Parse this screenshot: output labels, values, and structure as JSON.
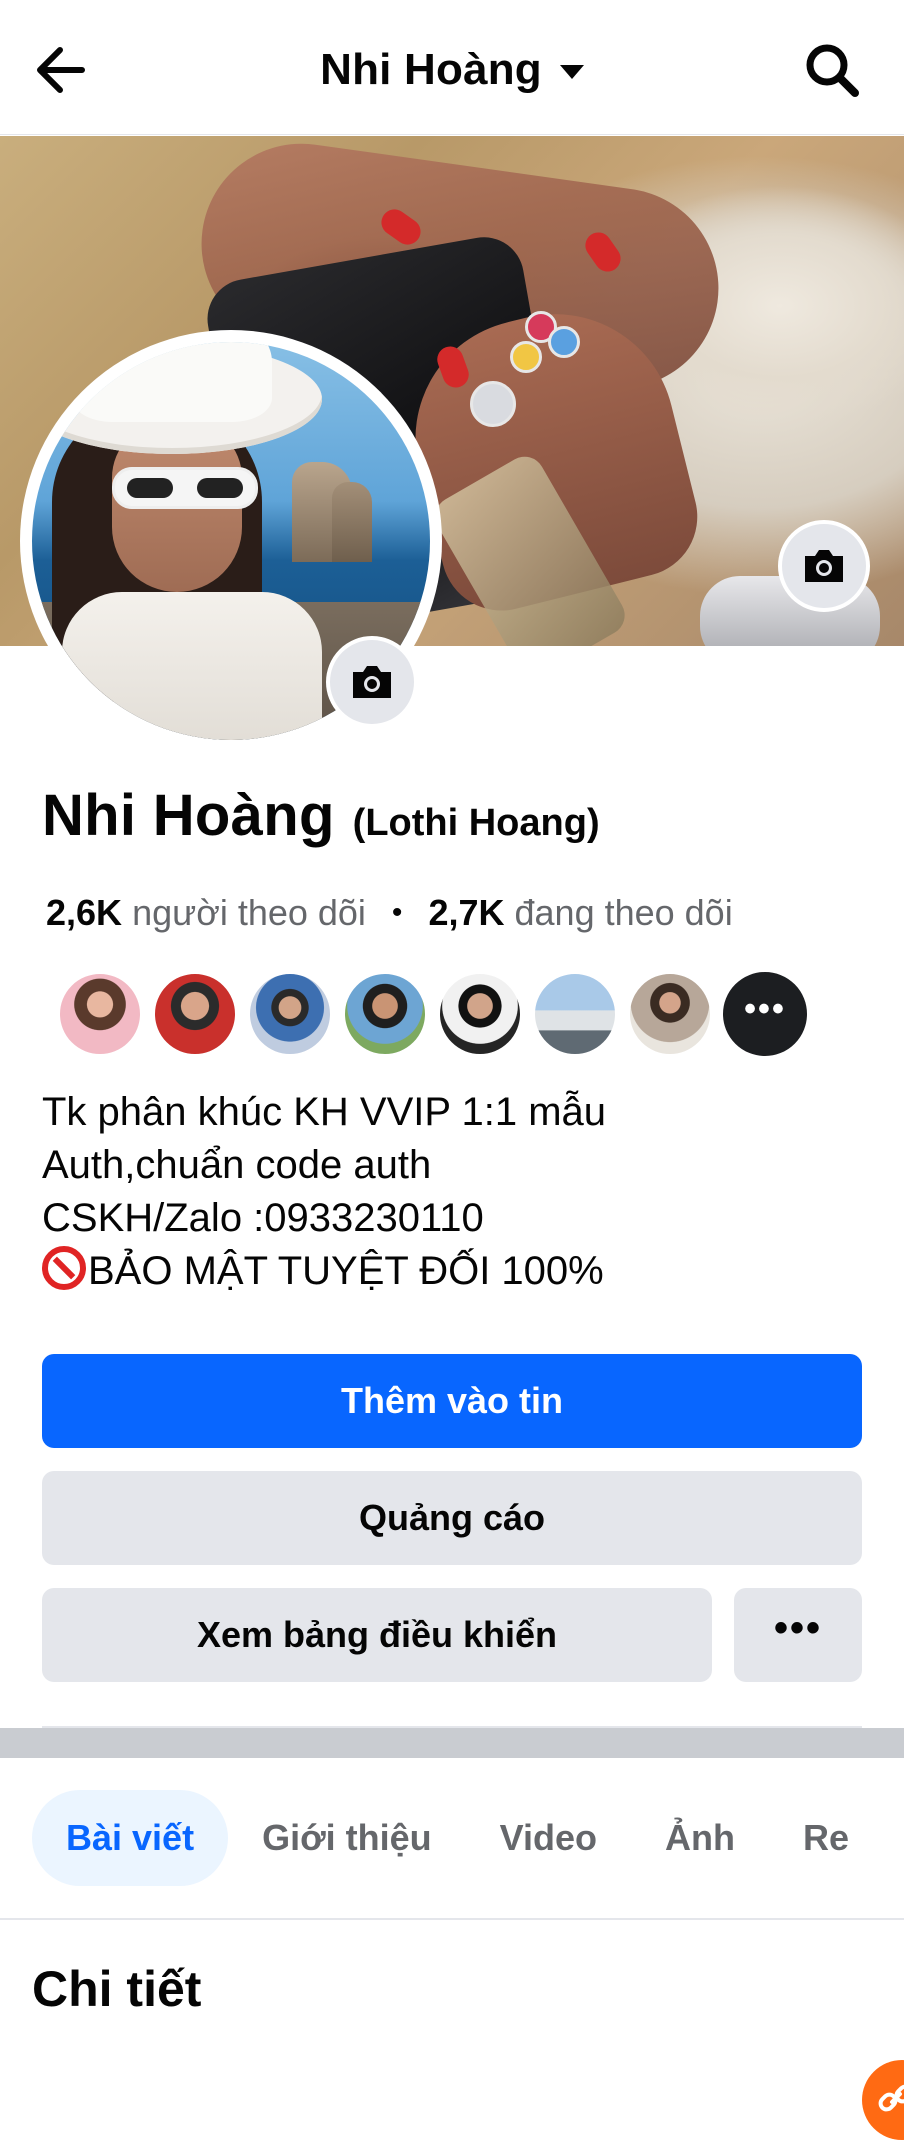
{
  "header": {
    "title": "Nhi Hoàng",
    "back_icon": "arrow-left-icon",
    "search_icon": "search-icon"
  },
  "profile": {
    "name": "Nhi Hoàng",
    "alt_name": "(Lothi Hoang)",
    "followers_count": "2,6K",
    "followers_label": "người theo dõi",
    "following_count": "2,7K",
    "following_label": "đang theo dõi",
    "separator": "•"
  },
  "friends": {
    "more_label": "•••"
  },
  "bio": {
    "line1": "Tk phân khúc KH VVIP 1:1 mẫu",
    "line2": "Auth,chuẩn code auth",
    "line3": "CSKH/Zalo :0933230110",
    "line4": "BẢO MẬT TUYỆT ĐỐI 100%"
  },
  "buttons": {
    "add_story": "Thêm vào tin",
    "ads": "Quảng cáo",
    "dashboard": "Xem bảng điều khiển",
    "more": "•••"
  },
  "tabs": [
    {
      "label": "Bài viết",
      "active": true
    },
    {
      "label": "Giới thiệu",
      "active": false
    },
    {
      "label": "Video",
      "active": false
    },
    {
      "label": "Ảnh",
      "active": false
    },
    {
      "label": "Re",
      "active": false
    }
  ],
  "details": {
    "title": "Chi tiết"
  },
  "colors": {
    "primary": "#0866ff",
    "secondary_button": "#e4e6eb",
    "muted_text": "#65676b",
    "active_tab_bg": "#ebf5ff"
  }
}
